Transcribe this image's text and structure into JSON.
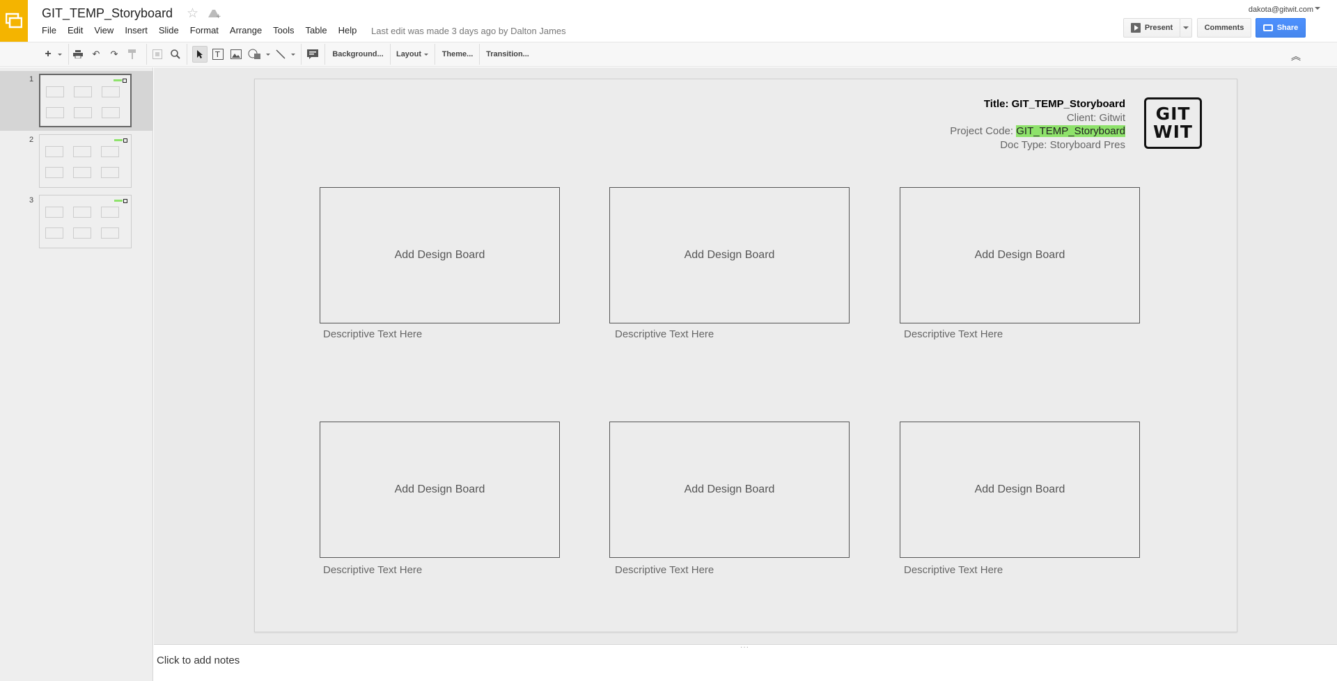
{
  "app": {
    "doc_title": "GIT_TEMP_Storyboard",
    "last_edit": "Last edit was made 3 days ago by Dalton James",
    "user_email": "dakota@gitwit.com",
    "brand_color": "#f4b400"
  },
  "menu": [
    "File",
    "Edit",
    "View",
    "Insert",
    "Slide",
    "Format",
    "Arrange",
    "Tools",
    "Table",
    "Help"
  ],
  "header_buttons": {
    "present": "Present",
    "comments": "Comments",
    "share": "Share"
  },
  "toolbar": {
    "icons": [
      "new-slide-icon",
      "dropdown-caret-icon",
      "print-icon",
      "undo-icon",
      "redo-icon",
      "paint-format-icon",
      "zoom-fit-icon",
      "zoom-icon",
      "select-icon",
      "text-box-icon",
      "image-icon",
      "shape-icon",
      "line-icon",
      "comment-icon",
      "collapse-icon"
    ],
    "background": "Background...",
    "layout": "Layout",
    "theme": "Theme...",
    "transition": "Transition..."
  },
  "filmstrip": {
    "slides": [
      "1",
      "2",
      "3"
    ],
    "active_index": 0
  },
  "slide": {
    "title_label": "Title: GIT_TEMP_Storyboard",
    "client_label": "Client: Gitwit",
    "project_code_prefix": "Project Code: ",
    "project_code_value": "GIT_TEMP_Storyboard",
    "doc_type_label": "Doc Type: Storyboard Pres",
    "logo_line1": "GIT",
    "logo_line2": "WIT",
    "highlight_color": "#8ee26b",
    "boards": [
      {
        "label": "Add Design Board",
        "caption": "Descriptive Text Here"
      },
      {
        "label": "Add Design Board",
        "caption": "Descriptive Text Here"
      },
      {
        "label": "Add Design Board",
        "caption": "Descriptive Text Here"
      },
      {
        "label": "Add Design Board",
        "caption": "Descriptive Text Here"
      },
      {
        "label": "Add Design Board",
        "caption": "Descriptive Text Here"
      },
      {
        "label": "Add Design Board",
        "caption": "Descriptive Text Here"
      }
    ]
  },
  "notes": {
    "placeholder": "Click to add notes"
  }
}
